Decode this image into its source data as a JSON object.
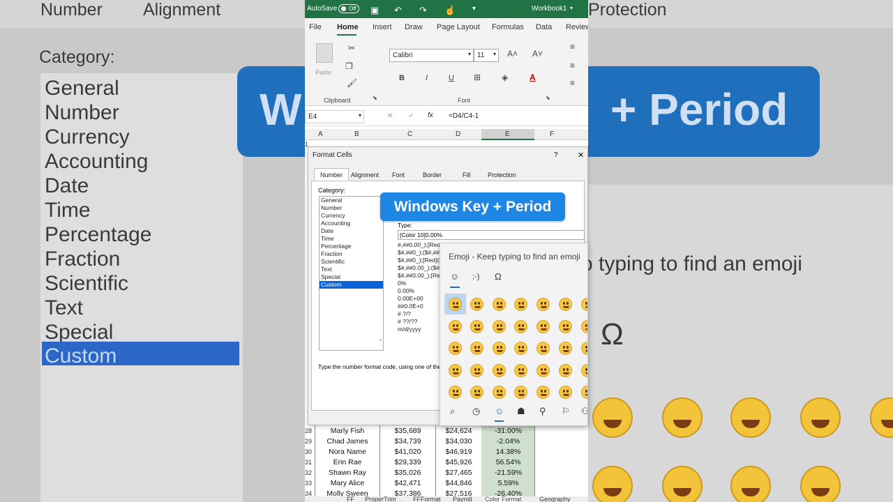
{
  "window": {
    "autosave": "AutoSave",
    "toggle": "Off",
    "workbook": "Workbook1"
  },
  "ribbon_tabs": [
    "File",
    "Home",
    "Insert",
    "Draw",
    "Page Layout",
    "Formulas",
    "Data",
    "Review"
  ],
  "ribbon": {
    "paste": "Paste",
    "clipboard": "Clipboard",
    "font_name": "Calibri",
    "font_size": "11",
    "font_group": "Font",
    "bold": "B",
    "italic": "I",
    "underline": "U"
  },
  "formula_bar": {
    "cell_ref": "E4",
    "formula": "=D4/C4-1",
    "fx": "fx"
  },
  "columns": [
    "A",
    "B",
    "C",
    "D",
    "E",
    "F"
  ],
  "dialog": {
    "title": "Format Cells",
    "help": "?",
    "close": "✕",
    "tabs": [
      "Number",
      "Alignment",
      "Font",
      "Border",
      "Fill",
      "Protection"
    ],
    "category_label": "Category:",
    "categories": [
      "General",
      "Number",
      "Currency",
      "Accounting",
      "Date",
      "Time",
      "Percentage",
      "Fraction",
      "Scientific",
      "Text",
      "Special",
      "Custom"
    ],
    "selected_category": "Custom",
    "type_label": "Type:",
    "type_value": "[Color 10]0.00%",
    "type_list": [
      "#,##0.00_);[Red]",
      "$#,##0_);($#,##0",
      "$#,##0_);[Red]($",
      "$#,##0.00_);($#,",
      "$#,##0.00_);[Red",
      "0%",
      "0.00%",
      "0.00E+00",
      "##0.0E+0",
      "# ?/?",
      "# ??/??",
      "m/d/yyyy"
    ],
    "hint": "Type the number format code, using one of the e"
  },
  "banner": "Windows Key + Period",
  "emoji_panel": {
    "hint": "Emoji - Keep typing to find an emoji",
    "tabs": [
      "☺",
      ";-)",
      "Ω"
    ]
  },
  "rows": [
    {
      "num": "28",
      "name": "Marly Fish",
      "c": "$35,689",
      "d": "$24,624",
      "e": "-31.00%"
    },
    {
      "num": "29",
      "name": "Chad James",
      "c": "$34,739",
      "d": "$34,030",
      "e": "-2.04%"
    },
    {
      "num": "30",
      "name": "Nora Name",
      "c": "$41,020",
      "d": "$46,919",
      "e": "14.38%"
    },
    {
      "num": "31",
      "name": "Erin Rae",
      "c": "$29,339",
      "d": "$45,926",
      "e": "56.54%"
    },
    {
      "num": "32",
      "name": "Shawn Ray",
      "c": "$35,026",
      "d": "$27,465",
      "e": "-21.59%"
    },
    {
      "num": "33",
      "name": "Mary Alice",
      "c": "$42,471",
      "d": "$44,846",
      "e": "5.59%"
    },
    {
      "num": "34",
      "name": "Molly Sween",
      "c": "$37,386",
      "d": "$27,516",
      "e": "-26.40%"
    }
  ],
  "sheet_tabs": [
    "FF",
    "ProperTrim",
    "FFFormat",
    "Payroll",
    "Color Format",
    "Geography"
  ],
  "bg_left": {
    "tabs": [
      "Number",
      "Alignment"
    ],
    "category_label": "Category:"
  },
  "bg_right": {
    "tab": "Protection",
    "banner_part": "+ Period",
    "hint_part": "o typing to find an emoji",
    "omega": "Ω"
  }
}
